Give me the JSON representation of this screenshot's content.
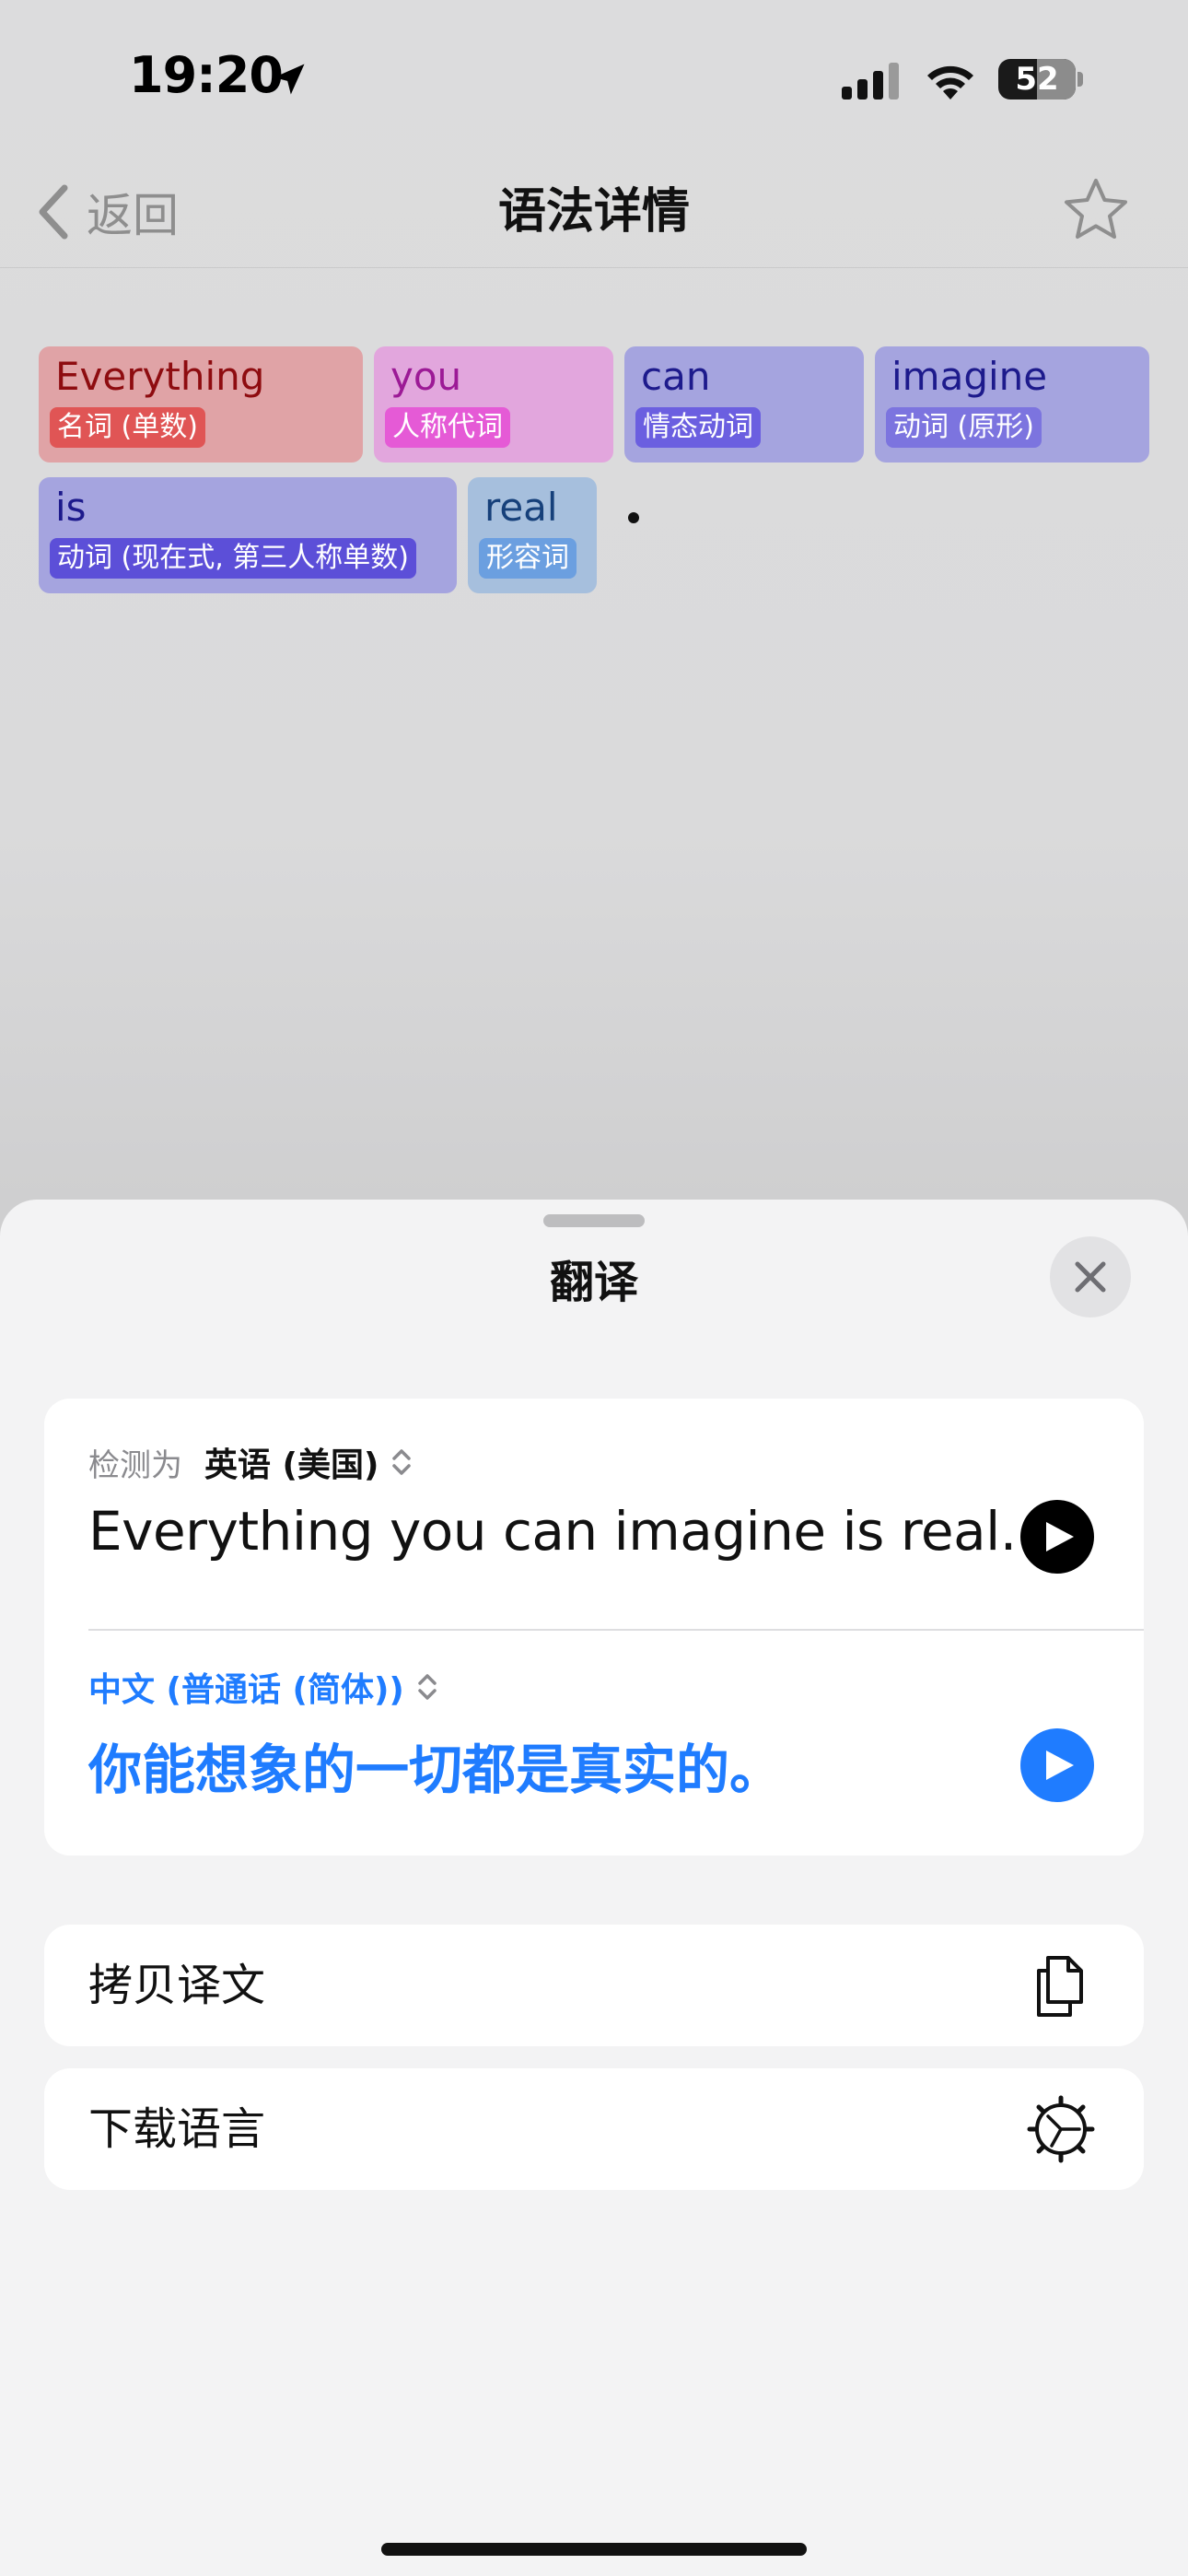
{
  "status_bar": {
    "time": "19:20",
    "battery": "52",
    "icons": [
      "location-arrow-icon",
      "cellular-signal-icon",
      "wifi-icon",
      "battery-icon"
    ]
  },
  "navbar": {
    "back_label": "返回",
    "title": "语法详情",
    "icons": [
      "chevron-left-icon",
      "star-icon"
    ]
  },
  "tokens": [
    {
      "word": "Everything",
      "tag": "名词 (单数)",
      "bg": "#e0a3a6",
      "fg": "#8e0c10",
      "tagbg": "#e05555"
    },
    {
      "word": "you",
      "tag": "人称代词",
      "bg": "#e2a6dd",
      "fg": "#9c1a96",
      "tagbg": "#e55ad6"
    },
    {
      "word": "can",
      "tag": "情态动词",
      "bg": "#a5a4df",
      "fg": "#1d1a8c",
      "tagbg": "#6b5fe0"
    },
    {
      "word": "imagine",
      "tag": "动词 (原形)",
      "bg": "#a5a4df",
      "fg": "#1d1a8c",
      "tagbg": "#7c74df"
    },
    {
      "word": "is",
      "tag": "动词 (现在式, 第三人称单数)",
      "bg": "#a5a4df",
      "fg": "#1d1a8c",
      "tagbg": "#5c4fd8"
    },
    {
      "word": "real",
      "tag": "形容词",
      "bg": "#a6bfdd",
      "fg": "#16407a",
      "tagbg": "#6b9fe0"
    }
  ],
  "sheet": {
    "title": "翻译",
    "source": {
      "detect_label": "检测为",
      "language": "英语 (美国)",
      "text": "Everything you can imagine is real."
    },
    "target": {
      "language": "中文 (普通话 (简体))",
      "text": "你能想象的一切都是真实的。"
    },
    "actions": [
      {
        "label": "拷贝译文",
        "icon": "copy-documents-icon"
      },
      {
        "label": "下载语言",
        "icon": "download-language-gear-icon"
      }
    ]
  },
  "colors": {
    "accent": "#1f7cff",
    "sheet_bg": "#f3f3f4"
  }
}
